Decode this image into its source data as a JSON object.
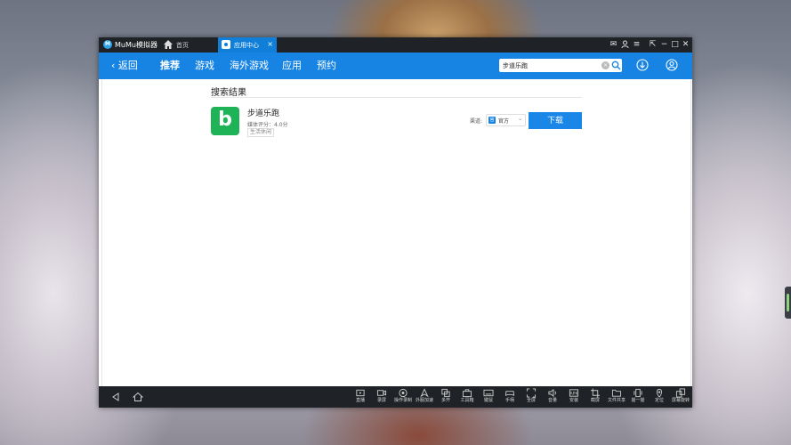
{
  "window": {
    "app_name": "MuMu模拟器"
  },
  "tabs": [
    {
      "label": "首页",
      "icon": "home-icon"
    },
    {
      "label": "应用中心",
      "icon": "app-center-icon",
      "close": "×"
    }
  ],
  "window_controls": {
    "mail": "✉",
    "user": "◯",
    "settings": "≡",
    "restore": "⇱",
    "minimize": "−",
    "maximize": "□",
    "close": "✕"
  },
  "nav": {
    "back_label": "返回",
    "items": [
      "推荐",
      "游戏",
      "海外游戏",
      "应用",
      "预约"
    ],
    "active_index": 0,
    "search": {
      "value": "步道乐跑",
      "placeholder": ""
    }
  },
  "results": {
    "title": "搜索结果",
    "app": {
      "name": "步道乐跑",
      "icon_letter": "b",
      "icon_color": "#1fb358",
      "rating": "媒体评分：4.0分",
      "tag": "生活休闲",
      "channel_label": "渠道:",
      "channel_value": "官方",
      "download_label": "下载"
    }
  },
  "toolbar": [
    {
      "label": "直播",
      "icon": "live-icon"
    },
    {
      "label": "录屏",
      "icon": "record-icon"
    },
    {
      "label": "操作录制",
      "icon": "macro-icon"
    },
    {
      "label": "外服加速",
      "icon": "accelerate-icon"
    },
    {
      "label": "多开",
      "icon": "multi-instance-icon"
    },
    {
      "label": "工具箱",
      "icon": "toolbox-icon"
    },
    {
      "label": "键鼠",
      "icon": "keyboard-icon"
    },
    {
      "label": "手柄",
      "icon": "gamepad-icon"
    },
    {
      "label": "全屏",
      "icon": "fullscreen-icon"
    },
    {
      "label": "音量",
      "icon": "volume-icon"
    },
    {
      "label": "安装",
      "icon": "apk-icon"
    },
    {
      "label": "截屏",
      "icon": "screenshot-icon"
    },
    {
      "label": "文件共享",
      "icon": "folder-icon"
    },
    {
      "label": "摇一摇",
      "icon": "shake-icon"
    },
    {
      "label": "定位",
      "icon": "location-icon"
    },
    {
      "label": "屏幕旋转",
      "icon": "rotate-icon"
    }
  ],
  "colors": {
    "accent": "#1784e4",
    "chrome": "#1f2226",
    "download": "#1a86e8"
  }
}
